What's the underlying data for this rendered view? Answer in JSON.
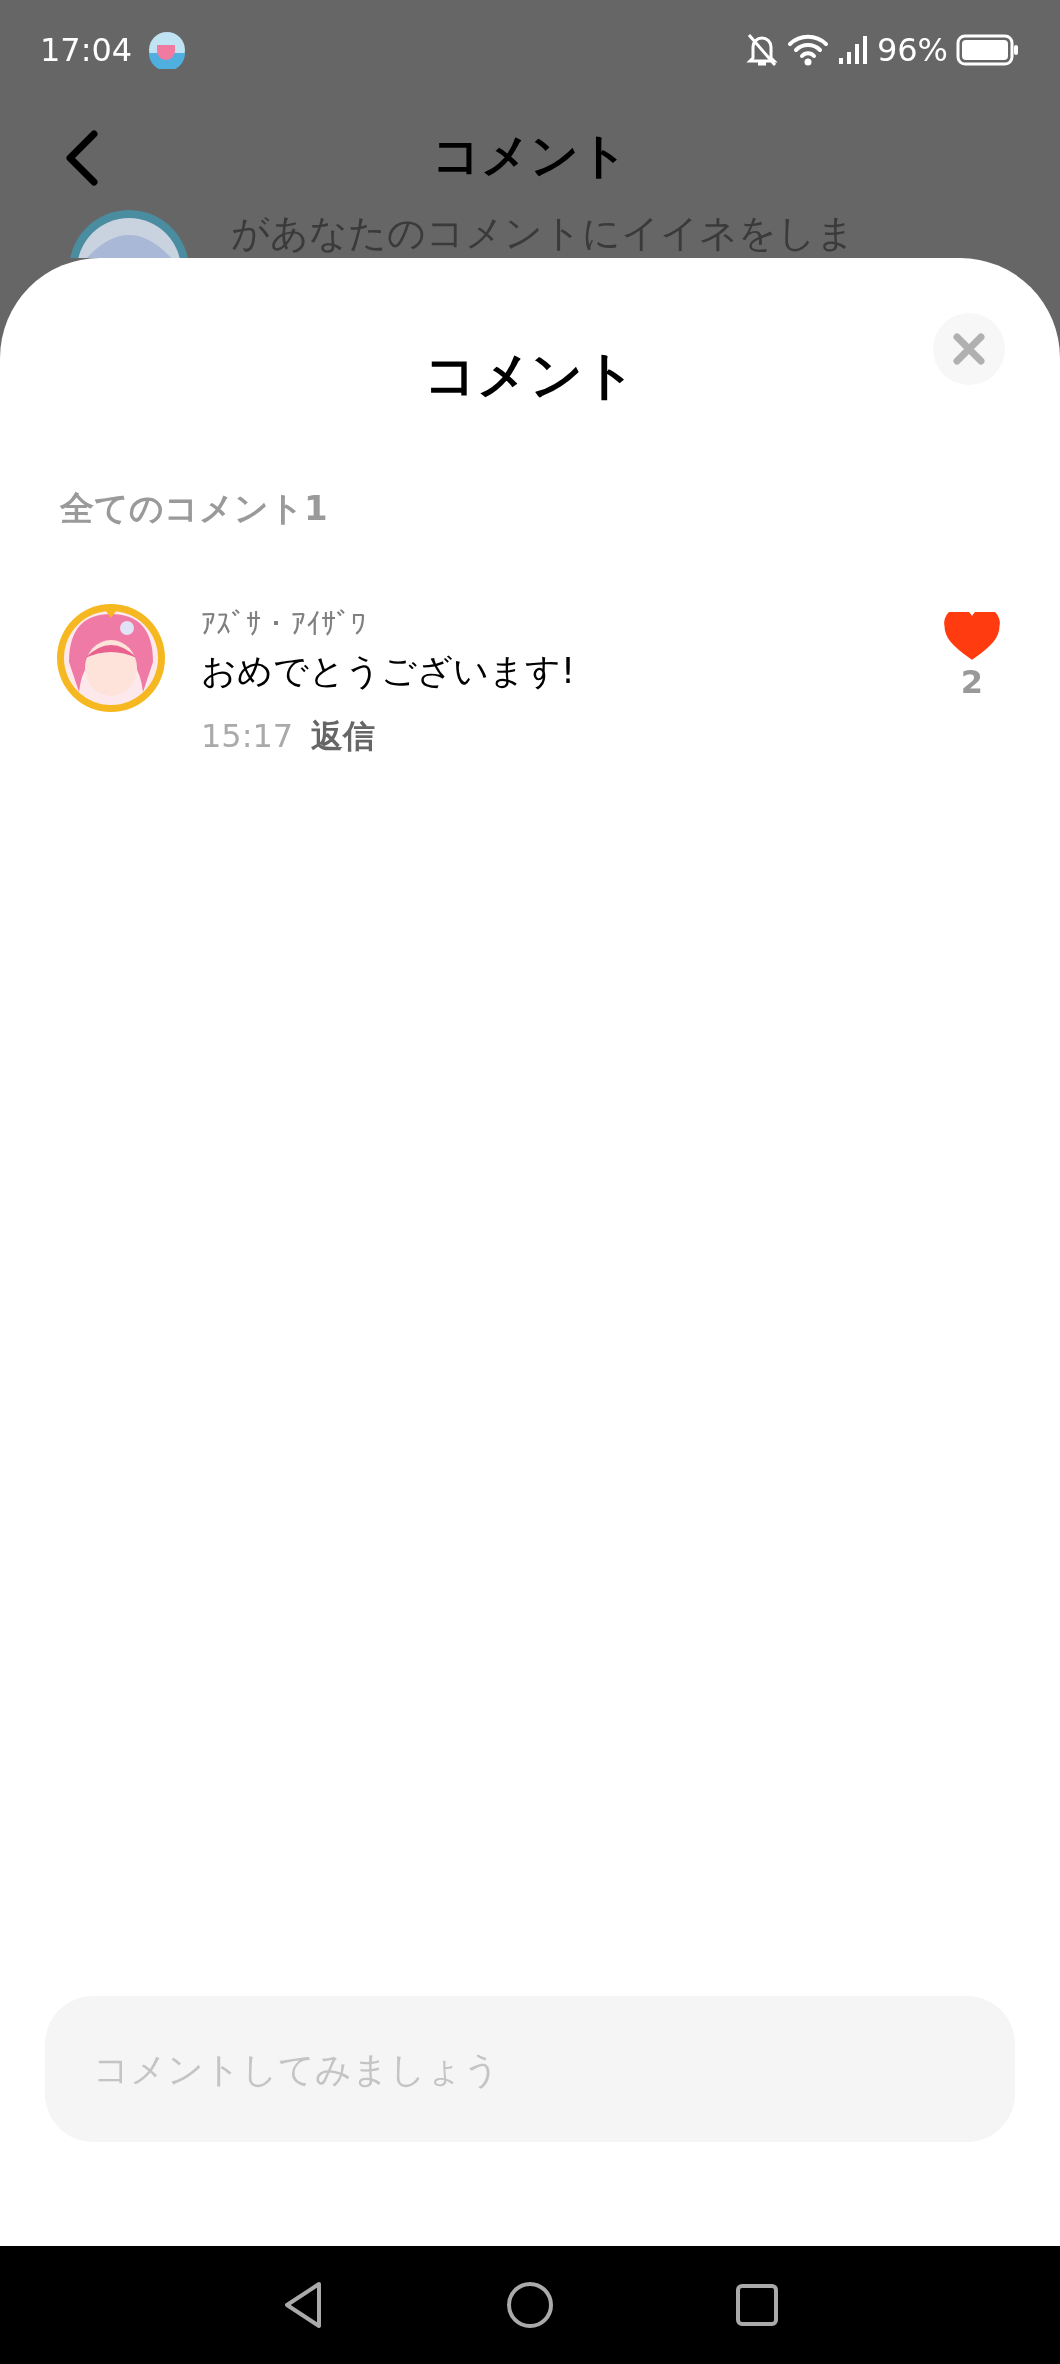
{
  "status_bar": {
    "time": "17:04",
    "battery": "96%"
  },
  "background_page": {
    "title": "コメント",
    "notification_text": "があなたのコメントにイイネをしま"
  },
  "sheet": {
    "title": "コメント",
    "section_label": "全てのコメント1",
    "comments": [
      {
        "author": "ｱｽﾞｻ・ｱｲｻﾞﾜ",
        "text": "おめでとうございます!",
        "time": "15:17",
        "reply": "返信",
        "liked": true,
        "likes": "2"
      }
    ],
    "input": {
      "placeholder": "コメントしてみましょう"
    }
  }
}
